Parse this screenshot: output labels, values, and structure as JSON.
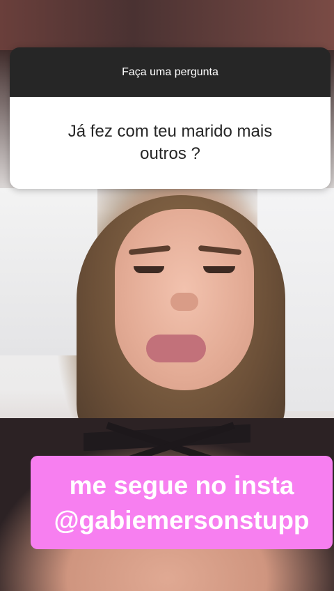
{
  "question_sticker": {
    "header": "Faça uma pergunta",
    "question": "Já fez com teu marido mais outros ?"
  },
  "promo_sticker": {
    "line1": "me segue no insta",
    "line2": "@gabiemersonstupp",
    "color": "#f77ff0"
  },
  "colors": {
    "card_header": "#262626",
    "card_body": "#ffffff"
  }
}
